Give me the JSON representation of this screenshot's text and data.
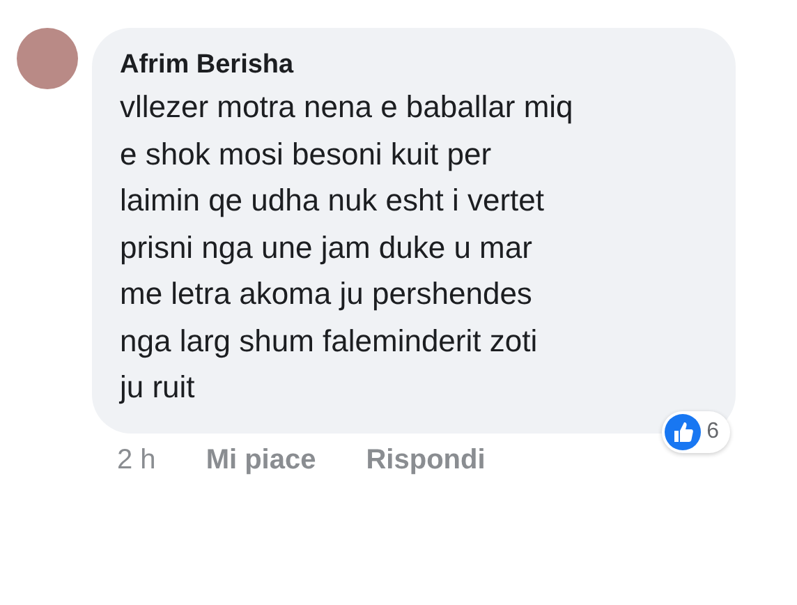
{
  "comment": {
    "author": "Afrim Berisha",
    "text": "vllezer motra nena e baballar miq\ne shok mosi besoni kuit per\nlaimin qe udha nuk esht i vertet\nprisni nga une jam duke u mar\nme letra akoma ju pershendes\nnga larg shum faleminderit zoti\nju ruit",
    "time": "2 h",
    "actions": [
      "Mi piace",
      "Rispondi"
    ],
    "reactions": {
      "count": "6"
    }
  }
}
